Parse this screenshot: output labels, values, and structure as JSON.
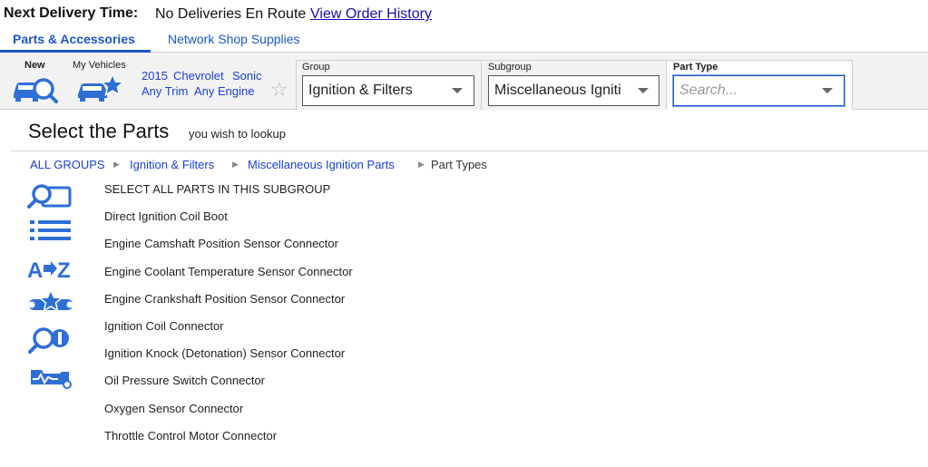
{
  "delivery": {
    "label": "Next Delivery Time:",
    "value": "No Deliveries En Route",
    "history_link": "View Order History"
  },
  "tabs": [
    {
      "label": "Parts & Accessories",
      "active": true
    },
    {
      "label": "Network Shop Supplies",
      "active": false
    }
  ],
  "vehicle": {
    "new_label": "New",
    "my_vehicles_label": "My Vehicles",
    "year": "2015",
    "make": "Chevrolet",
    "model": "Sonic",
    "trim": "Any Trim",
    "engine": "Any Engine"
  },
  "filters": {
    "group_label": "Group",
    "group_value": "Ignition & Filters",
    "subgroup_label": "Subgroup",
    "subgroup_value": "Miscellaneous Igniti",
    "parttype_label": "Part Type",
    "parttype_placeholder": "Search..."
  },
  "main": {
    "title": "Select the Parts",
    "subtitle": "you wish to lookup"
  },
  "breadcrumb": [
    {
      "label": "ALL GROUPS"
    },
    {
      "label": "Ignition & Filters"
    },
    {
      "label": "Miscellaneous Ignition Parts"
    },
    {
      "label": "Part Types"
    }
  ],
  "parts": [
    "SELECT ALL PARTS IN THIS SUBGROUP",
    "Direct Ignition Coil Boot",
    "Engine Camshaft Position Sensor Connector",
    "Engine Coolant Temperature Sensor Connector",
    "Engine Crankshaft Position Sensor Connector",
    "Ignition Coil Connector",
    "Ignition Knock (Detonation) Sensor Connector",
    "Oil Pressure Switch Connector",
    "Oxygen Sensor Connector",
    "Throttle Control Motor Connector"
  ],
  "side_icons": [
    "search-part-icon",
    "list-view-icon",
    "a-to-z-sort-icon",
    "tools-star-icon",
    "search-wrench-icon",
    "diagnostic-car-icon"
  ],
  "colors": {
    "accent": "#1a56c8",
    "icon_blue": "#2e6fd6",
    "link": "#1a3fd1"
  }
}
